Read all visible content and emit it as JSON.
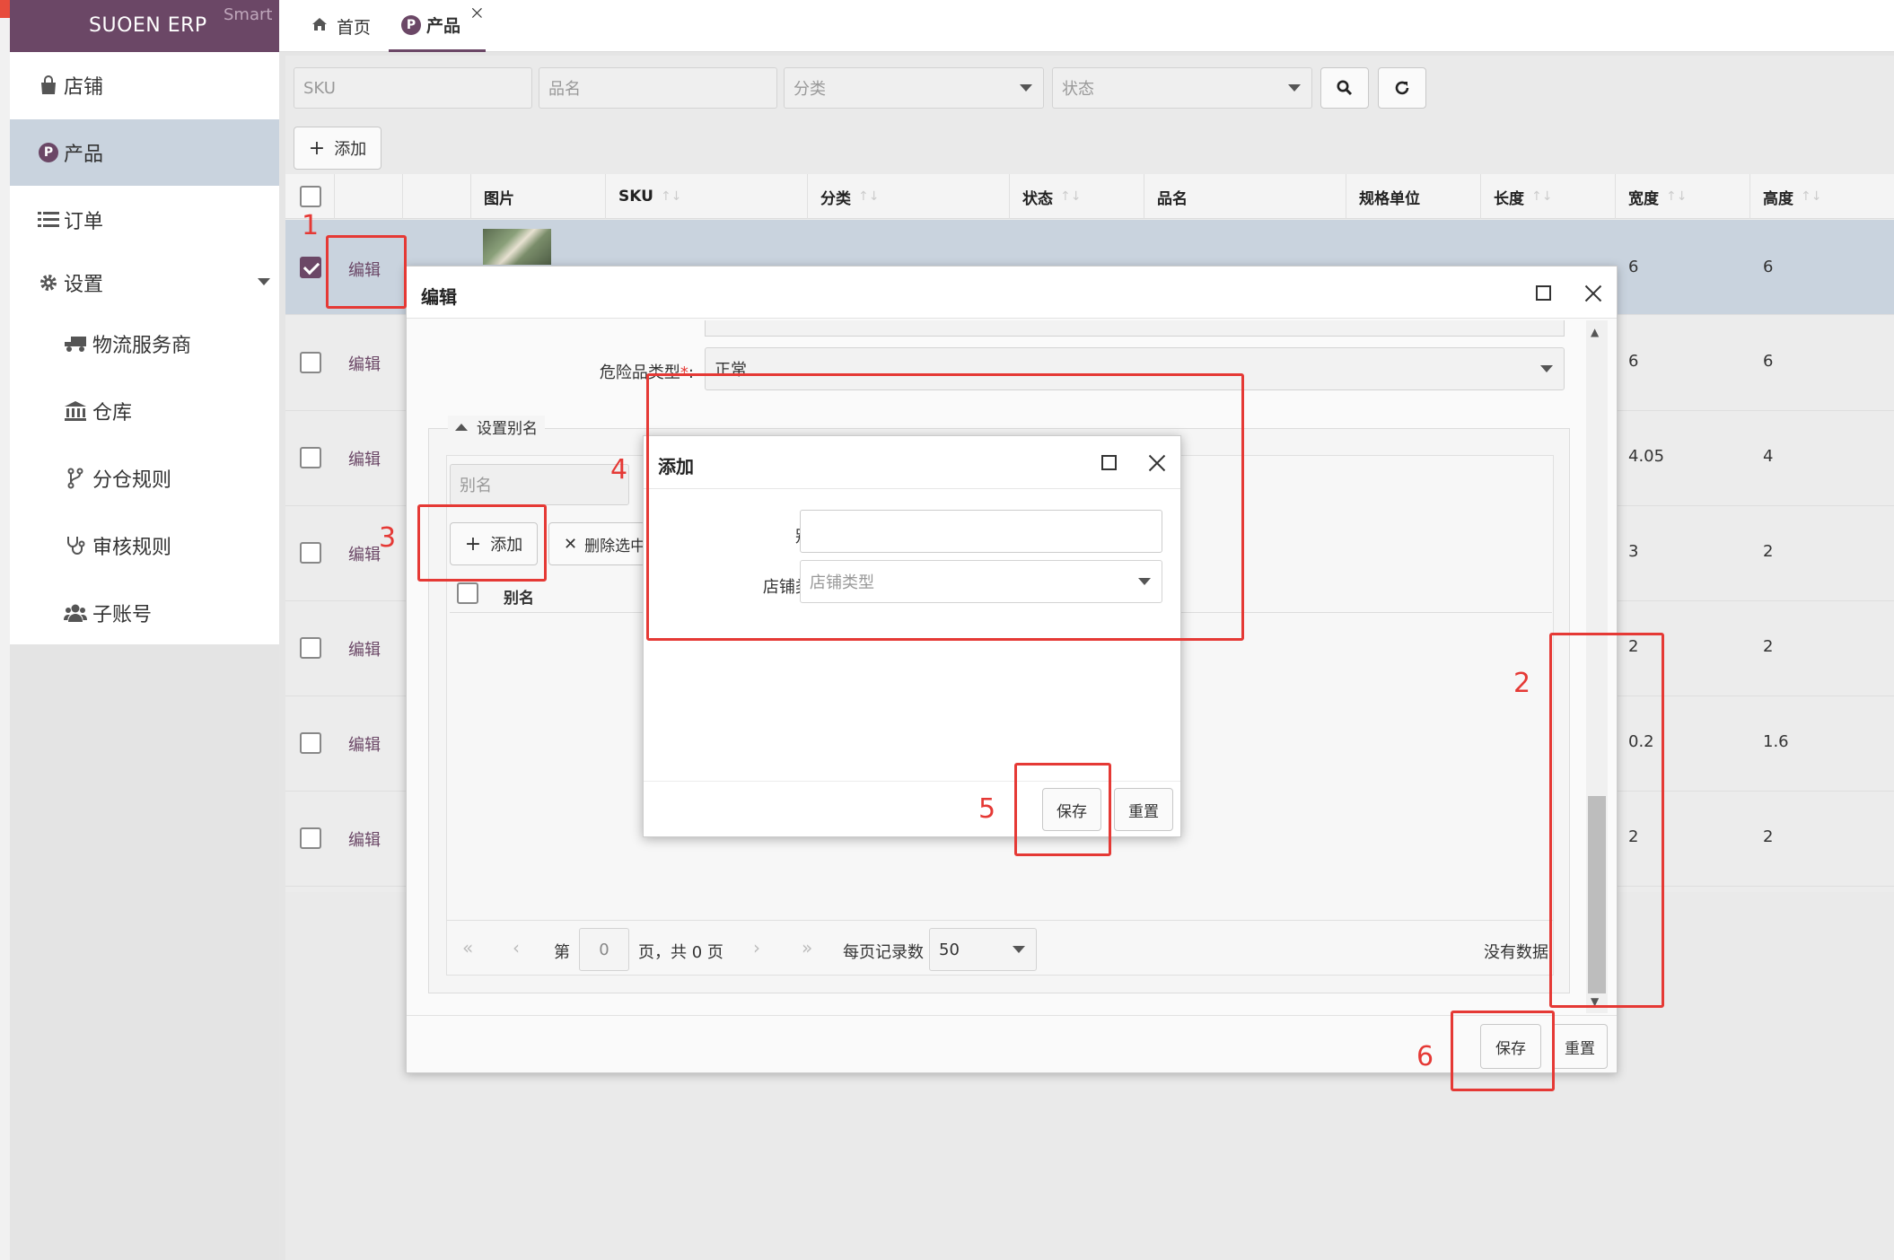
{
  "app": {
    "title": "SUOEN ERP",
    "edition": "Smart"
  },
  "sidebar": {
    "items": [
      {
        "label": "店铺",
        "icon": "shop-bag-icon"
      },
      {
        "label": "产品",
        "icon": "p-badge-icon",
        "badge": "P"
      },
      {
        "label": "订单",
        "icon": "list-icon"
      },
      {
        "label": "设置",
        "icon": "gear-icon"
      },
      {
        "label": "物流服务商",
        "icon": "truck-icon"
      },
      {
        "label": "仓库",
        "icon": "warehouse-icon"
      },
      {
        "label": "分仓规则",
        "icon": "branch-icon"
      },
      {
        "label": "审核规则",
        "icon": "stethoscope-icon"
      },
      {
        "label": "子账号",
        "icon": "users-icon"
      }
    ]
  },
  "tabs": [
    {
      "label": "首页",
      "icon": "home-icon"
    },
    {
      "label": "产品",
      "badge": "P"
    }
  ],
  "filters": {
    "sku": "SKU",
    "name": "品名",
    "category": "分类",
    "status": "状态"
  },
  "toolbar": {
    "add": "添加"
  },
  "table": {
    "headers": [
      "图片",
      "SKU",
      "分类",
      "状态",
      "品名",
      "规格单位",
      "长度",
      "宽度",
      "高度"
    ],
    "edit_label": "编辑",
    "rows": [
      {
        "width": "6",
        "height": "6"
      },
      {
        "width": "6",
        "height": "6"
      },
      {
        "width": "4.05",
        "height": "4"
      },
      {
        "width": "3",
        "height": "2"
      },
      {
        "width": "2",
        "height": "2"
      },
      {
        "width": "0.2",
        "height": "1.6"
      },
      {
        "width": "2",
        "height": "2"
      }
    ]
  },
  "edit_dialog": {
    "title": "编辑",
    "hazard_label": "危险品类型",
    "hazard_value": "正常",
    "alias_section": "设置别名",
    "alias_filter": "别名",
    "add": "添加",
    "delete_selected": "删除选中",
    "alias_col": "别名",
    "pager": {
      "page_prefix": "第",
      "page_value": "0",
      "page_suffix": "页，共",
      "total": "0",
      "total_suffix": "页",
      "per_page_label": "每页记录数",
      "per_page": "50",
      "no_data": "没有数据"
    },
    "save": "保存",
    "reset": "重置"
  },
  "add_dialog": {
    "title": "添加",
    "alias_label": "别名",
    "shop_type_label": "店铺类型",
    "shop_type_placeholder": "店铺类型",
    "save": "保存",
    "reset": "重置"
  },
  "annotations": [
    "1",
    "2",
    "3",
    "4",
    "5",
    "6"
  ],
  "colors": {
    "brand": "#6b4766",
    "annotation": "#e53935",
    "selected_row": "#c9d3de"
  }
}
